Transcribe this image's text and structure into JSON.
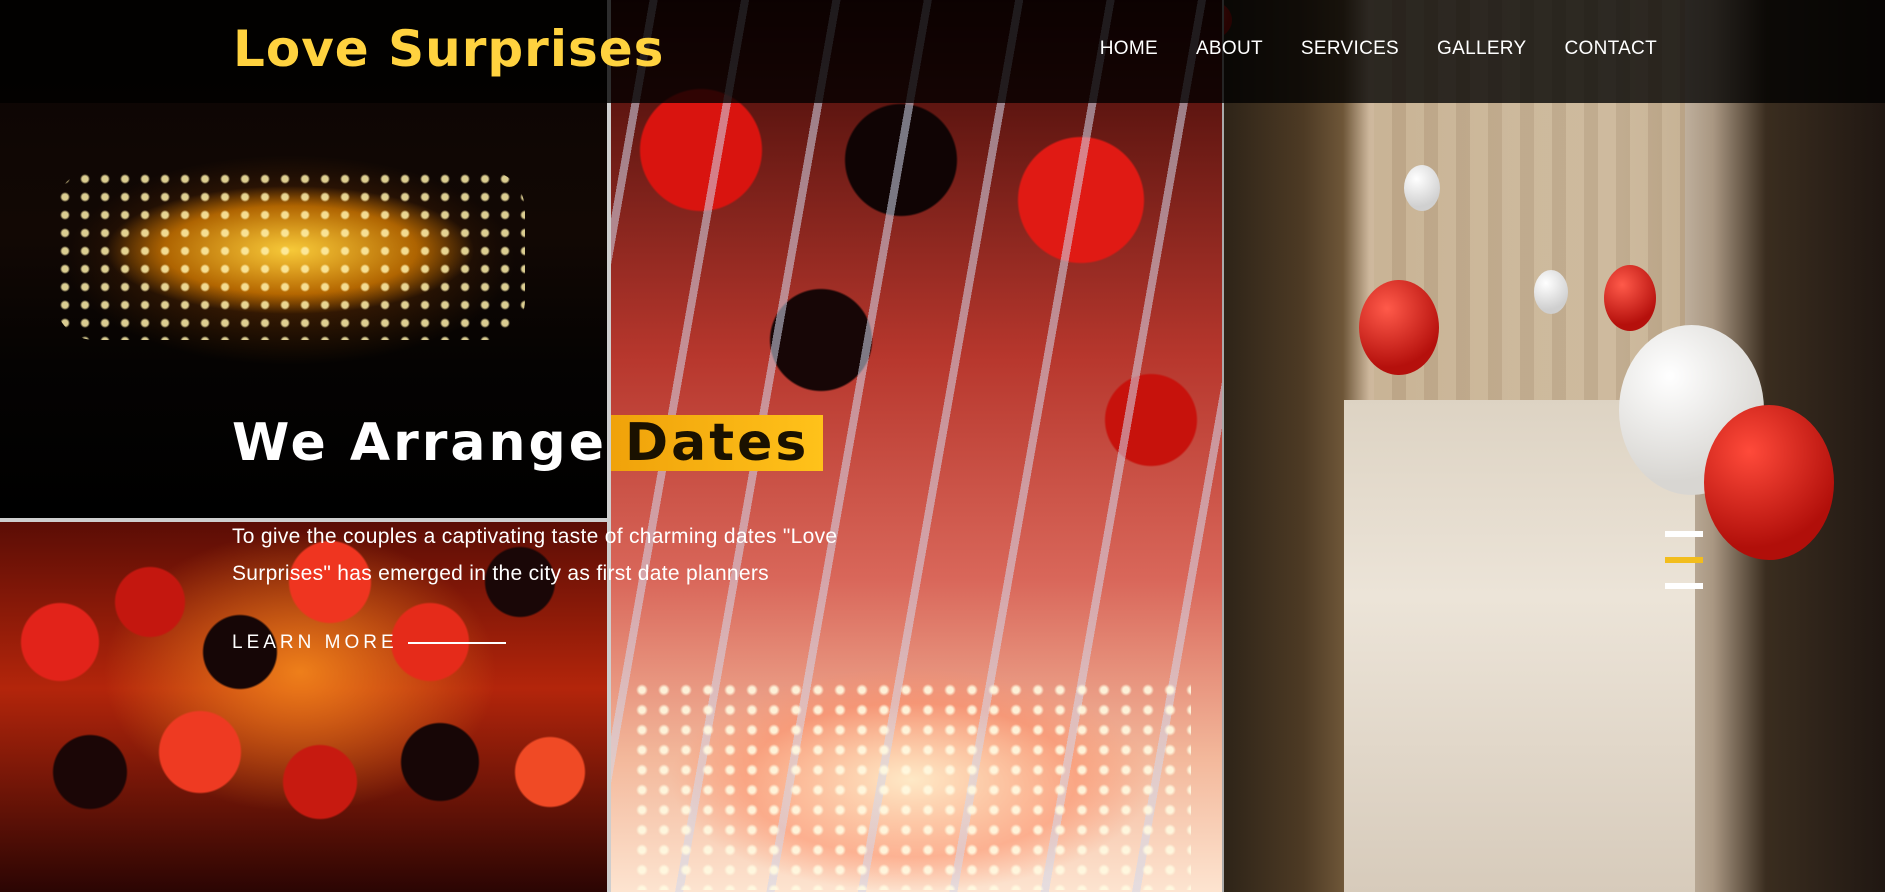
{
  "brand": {
    "name": "Love Surprises",
    "accent_color": "#ffd23f"
  },
  "nav": {
    "items": [
      {
        "label": "HOME"
      },
      {
        "label": "ABOUT"
      },
      {
        "label": "SERVICES"
      },
      {
        "label": "GALLERY"
      },
      {
        "label": "CONTACT"
      }
    ]
  },
  "hero": {
    "headline_prefix": "We Arrange",
    "headline_highlight": "Dates",
    "highlight_color": "#f5b014",
    "description": "To give the couples a captivating taste of charming dates \"Love Surprises\" has emerged in the city as first date planners",
    "cta_label": "LEARN MORE"
  },
  "slider": {
    "slide_count": 3,
    "active_index": 1,
    "active_color": "#f2bd1d"
  }
}
